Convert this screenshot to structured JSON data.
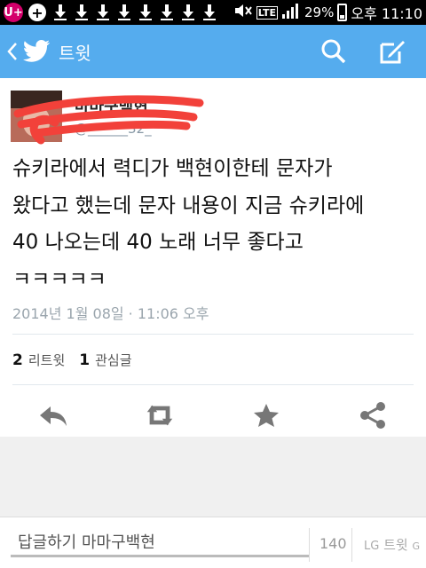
{
  "status_bar": {
    "carrier_badge": "U+",
    "plus_badge": "+",
    "network_label": "LTE",
    "battery_percent": "29%",
    "time": "오후 11:10",
    "notification_icons": [
      "download-icon",
      "download-icon",
      "download-icon",
      "download-icon",
      "download-icon",
      "download-icon",
      "download-icon",
      "download-icon"
    ]
  },
  "app_bar": {
    "title": "트윗",
    "color": "#55acee",
    "actions": [
      "search-icon",
      "compose-icon"
    ]
  },
  "tweet": {
    "display_name": "마마구백현",
    "handle": "@______32_",
    "text": "슈키라에서 력디가 백현이한테 문자가\n왔다고 했는데 문자 내용이 지금 슈키라에\n40 나오는데 40 노래 너무 좋다고\nㅋㅋㅋㅋㅋ",
    "timestamp": "2014년 1월 08일 · 11:06 오후",
    "retweet_count": "2",
    "retweet_label": "리트윗",
    "favorite_count": "1",
    "favorite_label": "관심글",
    "actions": [
      "reply-icon",
      "retweet-icon",
      "favorite-icon",
      "share-icon"
    ]
  },
  "reply": {
    "placeholder": "답글하기 마마구백현",
    "char_count": "140",
    "button_label": "트윗"
  },
  "overlay_watermark": "LG",
  "overlay_text": "G"
}
